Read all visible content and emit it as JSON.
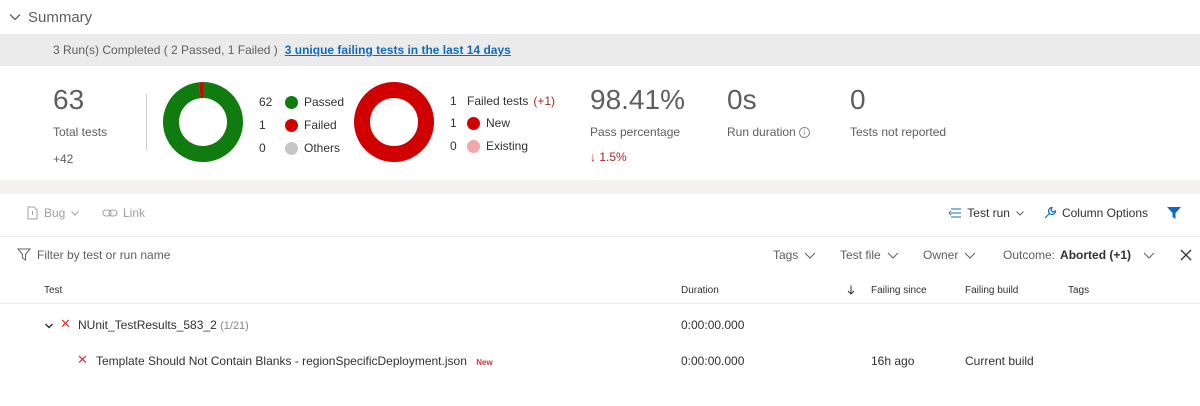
{
  "summary": {
    "title": "Summary",
    "run_info": "3 Run(s) Completed ( 2 Passed, 1 Failed )",
    "failing_link": "3 unique failing tests in the last 14 days"
  },
  "stats": {
    "total_tests": "63",
    "total_label": "Total tests",
    "total_delta": "+42",
    "outcome_legend": [
      {
        "count": "62",
        "label": "Passed",
        "color": "#107c10"
      },
      {
        "count": "1",
        "label": "Failed",
        "color": "#d00000"
      },
      {
        "count": "0",
        "label": "Others",
        "color": "#c8c6c4"
      }
    ],
    "failed_legend": [
      {
        "count": "1",
        "label": "Failed tests",
        "delta": "(+1)"
      },
      {
        "count": "1",
        "label": "New",
        "color": "#d00000"
      },
      {
        "count": "0",
        "label": "Existing",
        "color": "#f1a7a7"
      }
    ],
    "pass_percentage": "98.41%",
    "pass_label": "Pass percentage",
    "pass_change": "↓ 1.5%",
    "run_duration": "0s",
    "run_duration_label": "Run duration",
    "not_reported": "0",
    "not_reported_label": "Tests not reported"
  },
  "chart_data": [
    {
      "type": "pie",
      "categories": [
        "Passed",
        "Failed",
        "Others"
      ],
      "values": [
        62,
        1,
        0
      ]
    },
    {
      "type": "pie",
      "categories": [
        "New",
        "Existing"
      ],
      "values": [
        1,
        0
      ]
    }
  ],
  "toolbar": {
    "bug": "Bug",
    "link": "Link",
    "test_run": "Test run",
    "column_options": "Column Options"
  },
  "filters": {
    "placeholder": "Filter by test or run name",
    "tags": "Tags",
    "test_file": "Test file",
    "owner": "Owner",
    "outcome_label": "Outcome:",
    "outcome_value": "Aborted (+1)"
  },
  "table": {
    "columns": {
      "test": "Test",
      "duration": "Duration",
      "failing_since": "Failing since",
      "failing_build": "Failing build",
      "tags": "Tags"
    },
    "group": {
      "name": "NUnit_TestResults_583_2",
      "count": "(1/21)",
      "duration": "0:00:00.000"
    },
    "rows": [
      {
        "name": "Template Should Not Contain Blanks - regionSpecificDeployment.json",
        "tag": "New",
        "duration": "0:00:00.000",
        "failing_since": "16h ago",
        "failing_build": "Current build"
      }
    ]
  },
  "colors": {
    "passed": "#107c10",
    "failed": "#d00000",
    "others": "#c8c6c4",
    "existing": "#f1a7a7",
    "accent": "#0f6cbd"
  }
}
